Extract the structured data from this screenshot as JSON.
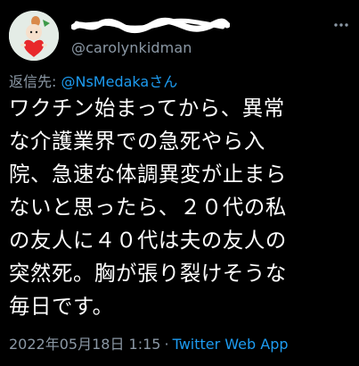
{
  "author": {
    "handle": "@carolynkidman"
  },
  "reply": {
    "prefix": "返信先: ",
    "user": "@NsMedaka",
    "suffix": "さん"
  },
  "tweet": {
    "lines": [
      "ワクチン始まってから、異常",
      "な介護業界での急死やら入",
      "院、急速な体調異変が止まら",
      "ないと思ったら、２０代の私",
      "の友人に４０代は夫の友人の",
      "突然死。胸が張り裂けそうな",
      "毎日です。"
    ]
  },
  "meta": {
    "timestamp": "2022年05月18日 1:15",
    "separator": "·",
    "source": "Twitter Web App"
  },
  "icons": {
    "avatar": "moomin-little-my-avatar",
    "more": "more-dots-icon"
  },
  "colors": {
    "background": "#000000",
    "text": "#ffffff",
    "secondary": "#8b98a5",
    "link": "#1d9bf0"
  }
}
